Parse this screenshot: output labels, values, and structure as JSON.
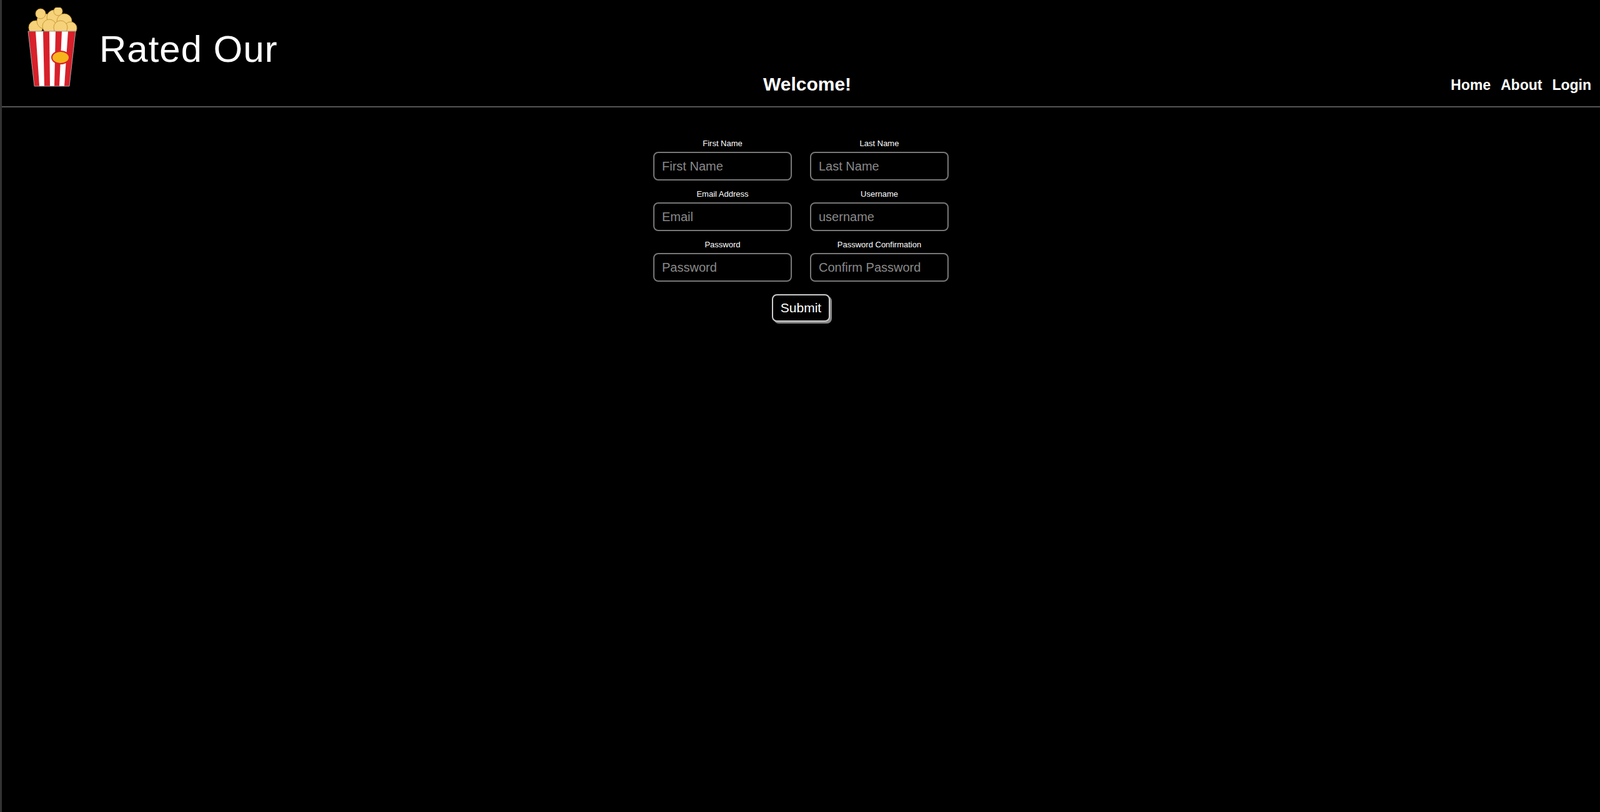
{
  "header": {
    "title": "Rated Our",
    "welcome": "Welcome!"
  },
  "nav": [
    "Home",
    "About",
    "Login"
  ],
  "form": {
    "fields": [
      {
        "label": "First Name",
        "placeholder": "First Name"
      },
      {
        "label": "Last Name",
        "placeholder": "Last Name"
      },
      {
        "label": "Email Address",
        "placeholder": "Email"
      },
      {
        "label": "Username",
        "placeholder": "username"
      },
      {
        "label": "Password",
        "placeholder": "Password"
      },
      {
        "label": "Password Confirmation",
        "placeholder": "Confirm Password"
      }
    ],
    "submit": "Submit"
  }
}
